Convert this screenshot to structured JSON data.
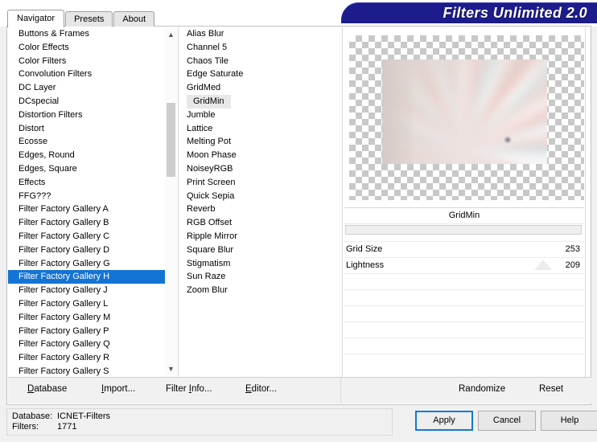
{
  "window": {
    "banner_title": "Filters Unlimited 2.0"
  },
  "tabs": [
    {
      "label": "Navigator",
      "active": true
    },
    {
      "label": "Presets",
      "active": false
    },
    {
      "label": "About",
      "active": false
    }
  ],
  "categories": {
    "items": [
      {
        "label": "Buttons & Frames"
      },
      {
        "label": "Color Effects"
      },
      {
        "label": "Color Filters"
      },
      {
        "label": "Convolution Filters"
      },
      {
        "label": "DC Layer"
      },
      {
        "label": "DCspecial"
      },
      {
        "label": "Distortion Filters"
      },
      {
        "label": "Distort"
      },
      {
        "label": "Ecosse"
      },
      {
        "label": "Edges, Round"
      },
      {
        "label": "Edges, Square"
      },
      {
        "label": "Effects"
      },
      {
        "label": "FFG???"
      },
      {
        "label": "Filter Factory Gallery A"
      },
      {
        "label": "Filter Factory Gallery B"
      },
      {
        "label": "Filter Factory Gallery C"
      },
      {
        "label": "Filter Factory Gallery D"
      },
      {
        "label": "Filter Factory Gallery G"
      },
      {
        "label": "Filter Factory Gallery H",
        "selected": true
      },
      {
        "label": "Filter Factory Gallery J"
      },
      {
        "label": "Filter Factory Gallery L"
      },
      {
        "label": "Filter Factory Gallery M"
      },
      {
        "label": "Filter Factory Gallery P"
      },
      {
        "label": "Filter Factory Gallery Q"
      },
      {
        "label": "Filter Factory Gallery R"
      },
      {
        "label": "Filter Factory Gallery S"
      }
    ],
    "selected": "Filter Factory Gallery H",
    "scroll_up_icon": "chevron-up-icon",
    "scroll_down_icon": "chevron-down-icon"
  },
  "filters": {
    "items": [
      {
        "label": "Alias Blur"
      },
      {
        "label": "Channel 5"
      },
      {
        "label": "Chaos Tile"
      },
      {
        "label": "Edge Saturate"
      },
      {
        "label": "GridMed"
      },
      {
        "label": "GridMin",
        "selected": true
      },
      {
        "label": "Jumble"
      },
      {
        "label": "Lattice"
      },
      {
        "label": "Melting Pot"
      },
      {
        "label": "Moon Phase"
      },
      {
        "label": "NoiseyRGB"
      },
      {
        "label": "Print Screen"
      },
      {
        "label": "Quick Sepia"
      },
      {
        "label": "Reverb"
      },
      {
        "label": "RGB Offset"
      },
      {
        "label": "Ripple Mirror"
      },
      {
        "label": "Square Blur"
      },
      {
        "label": "Stigmatism"
      },
      {
        "label": "Sun Raze"
      },
      {
        "label": "Zoom Blur"
      }
    ],
    "selected": "GridMin"
  },
  "preview": {
    "label": "filter-preview"
  },
  "parameters": {
    "title": "GridMin",
    "rows": [
      {
        "name": "Grid Size",
        "value": "253"
      },
      {
        "name": "Lightness",
        "value": "209"
      }
    ],
    "empty_row_count": 6
  },
  "actionbar": {
    "database_label": "Database",
    "database_accel": "D",
    "import_label": "Import...",
    "import_accel": "I",
    "filter_info_label": "Filter Info...",
    "filter_info_accel": "I",
    "editor_label": "Editor...",
    "editor_accel": "E",
    "randomize_label": "Randomize",
    "reset_label": "Reset"
  },
  "status": {
    "database_key": "Database:",
    "database_value": "ICNET-Filters",
    "filters_key": "Filters:",
    "filters_value": "1771"
  },
  "dialog_buttons": {
    "apply": "Apply",
    "cancel": "Cancel",
    "help": "Help"
  },
  "colors": {
    "banner_blue": "#1c1c8c",
    "selection_blue": "#1474d4",
    "focus_border_blue": "#0f7ad6",
    "panel_gray": "#f0f0f0"
  }
}
